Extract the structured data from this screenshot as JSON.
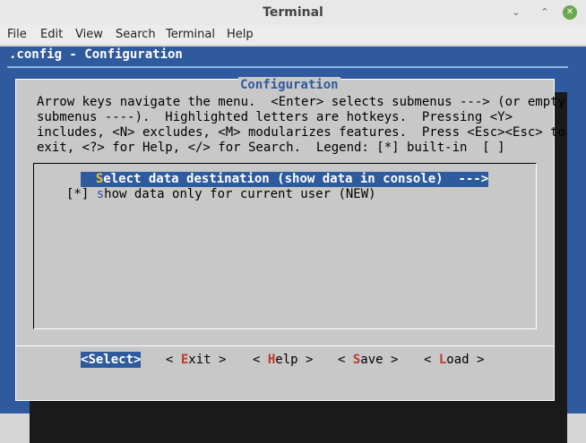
{
  "window": {
    "title": "Terminal",
    "min_icon": "⌄",
    "max_icon": "⌃",
    "close_icon": "✕"
  },
  "menubar": {
    "file": "File",
    "edit": "Edit",
    "view": "View",
    "search": "Search",
    "terminal": "Terminal",
    "help": "Help"
  },
  "terminal": {
    "title": ".config - Configuration"
  },
  "dialog": {
    "caption": "Configuration",
    "help_lines": [
      "Arrow keys navigate the menu.  <Enter> selects submenus ---> (or empty",
      "submenus ----).  Highlighted letters are hotkeys.  Pressing <Y>",
      "includes, <N> excludes, <M> modularizes features.  Press <Esc><Esc> to",
      "exit, <?> for Help, </> for Search.  Legend: [*] built-in  [ ]"
    ],
    "items": [
      {
        "prefix": "  ",
        "hotkey": "S",
        "rest": "elect data destination (show data in console)  --->"
      },
      {
        "prefix": "[*] ",
        "hotkey": "s",
        "rest": "how data only for current user (NEW)"
      }
    ],
    "buttons": {
      "select": {
        "lead": "<",
        "hotkey": "Select",
        "tail": ">"
      },
      "exit": {
        "lead": "< ",
        "hotkey": "E",
        "tail": "xit >"
      },
      "help": {
        "lead": "< ",
        "hotkey": "H",
        "tail": "elp >"
      },
      "save": {
        "lead": "< ",
        "hotkey": "S",
        "tail": "ave >"
      },
      "load": {
        "lead": "< ",
        "hotkey": "L",
        "tail": "oad >"
      }
    }
  },
  "colors": {
    "terminal_bg": "#2f5b9e",
    "dialog_bg": "#c8c8c8",
    "highlight_bg": "#2f5b9e",
    "hotkey_yellow": "#f1c232",
    "button_hotkey_red": "#c0392b"
  }
}
